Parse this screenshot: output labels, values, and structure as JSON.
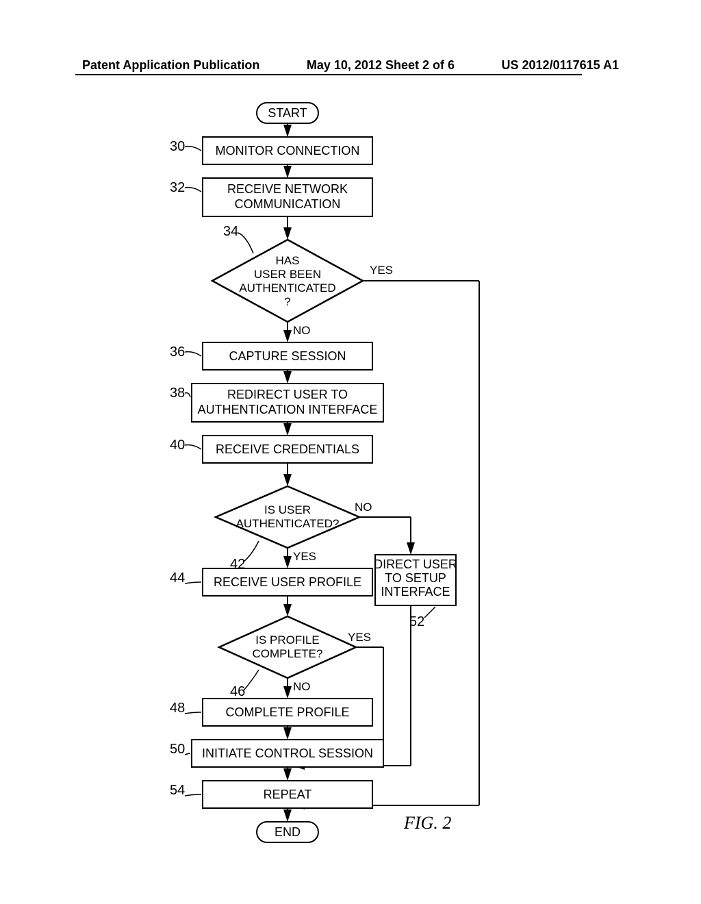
{
  "header": {
    "left": "Patent Application Publication",
    "center": "May 10, 2012  Sheet 2 of 6",
    "right": "US 2012/0117615 A1"
  },
  "figure_label": "FIG. 2",
  "terminals": {
    "start": "START",
    "end": "END"
  },
  "boxes": {
    "b30": "MONITOR CONNECTION",
    "b32_l1": "RECEIVE NETWORK",
    "b32_l2": "COMMUNICATION",
    "b36": "CAPTURE SESSION",
    "b38_l1": "REDIRECT USER TO",
    "b38_l2": "AUTHENTICATION INTERFACE",
    "b40": "RECEIVE CREDENTIALS",
    "b44": "RECEIVE USER PROFILE",
    "b48": "COMPLETE PROFILE",
    "b50": "INITIATE CONTROL SESSION",
    "b52_l1": "DIRECT USER",
    "b52_l2": "TO SETUP",
    "b52_l3": "INTERFACE",
    "b54": "REPEAT"
  },
  "diamonds": {
    "d34_l1": "HAS",
    "d34_l2": "USER BEEN",
    "d34_l3": "AUTHENTICATED",
    "d34_l4": "?",
    "d42_l1": "IS USER",
    "d42_l2": "AUTHENTICATED?",
    "d46_l1": "IS PROFILE",
    "d46_l2": "COMPLETE?"
  },
  "refs": {
    "r30": "30",
    "r32": "32",
    "r34": "34",
    "r36": "36",
    "r38": "38",
    "r40": "40",
    "r42": "42",
    "r44": "44",
    "r46": "46",
    "r48": "48",
    "r50": "50",
    "r52": "52",
    "r54": "54"
  },
  "edges": {
    "yes": "YES",
    "no": "NO"
  }
}
